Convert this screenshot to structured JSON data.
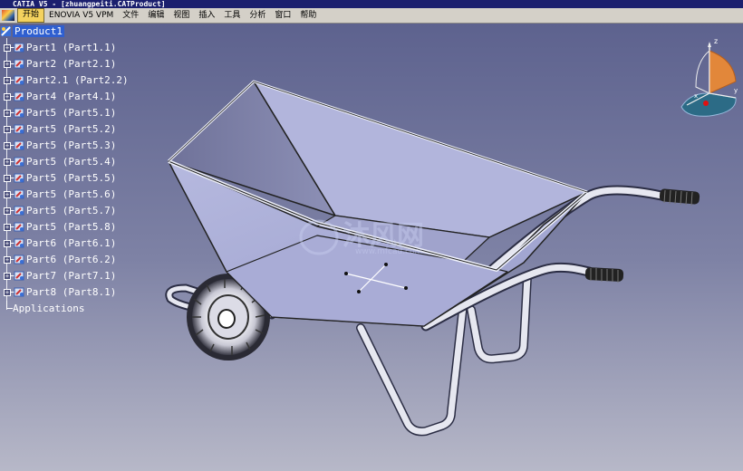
{
  "window": {
    "title": "CATIA V5 - [zhuangpeiti.CATProduct]"
  },
  "menu": [
    "开始",
    "ENOVIA V5 VPM",
    "文件",
    "编辑",
    "视图",
    "插入",
    "工具",
    "分析",
    "窗口",
    "帮助"
  ],
  "tree": {
    "root": "Product1",
    "parts": [
      "Part1 (Part1.1)",
      "Part2 (Part2.1)",
      "Part2.1 (Part2.2)",
      "Part4 (Part4.1)",
      "Part5 (Part5.1)",
      "Part5 (Part5.2)",
      "Part5 (Part5.3)",
      "Part5 (Part5.4)",
      "Part5 (Part5.5)",
      "Part5 (Part5.6)",
      "Part5 (Part5.7)",
      "Part5 (Part5.8)",
      "Part6 (Part6.1)",
      "Part6 (Part6.2)",
      "Part7 (Part7.1)",
      "Part8 (Part8.1)"
    ],
    "applications": "Applications"
  },
  "compass": {
    "z_label": "z",
    "x_label": "x",
    "y_label": "y"
  },
  "watermark": {
    "text": "沐风网",
    "subtext": "www.mfcad.com"
  },
  "colors": {
    "tray_fill": "#a7abd6",
    "frame": "#d9dbe8",
    "selection": "#2f5fd0",
    "menu_active": "#f4d25e"
  }
}
